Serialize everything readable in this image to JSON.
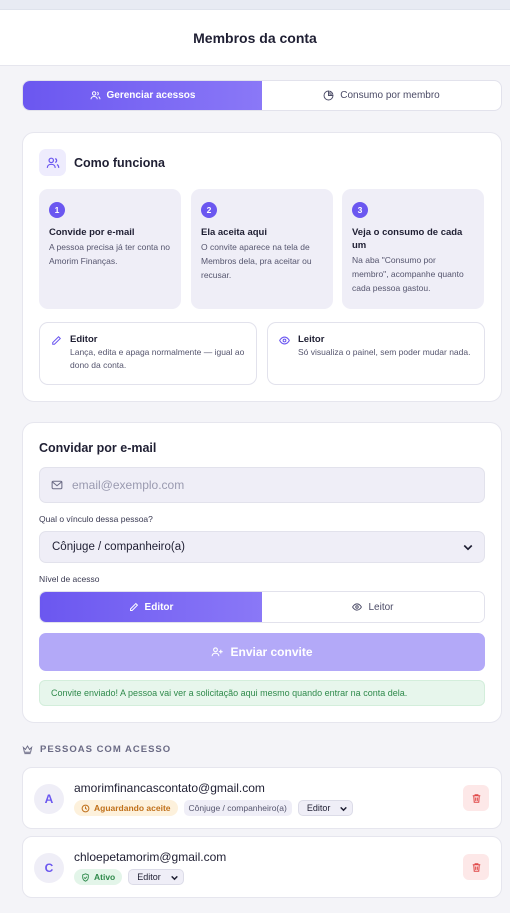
{
  "header": {
    "title": "Membros da conta"
  },
  "tabs": [
    {
      "label": "Gerenciar acessos",
      "icon": "users-icon",
      "active": true
    },
    {
      "label": "Consumo por membro",
      "icon": "pie-chart-icon",
      "active": false
    }
  ],
  "how_it_works": {
    "title": "Como funciona",
    "icon": "users-icon",
    "steps": [
      {
        "number": "1",
        "title": "Convide por e-mail",
        "description": "A pessoa precisa já ter conta no Amorim Finanças."
      },
      {
        "number": "2",
        "title": "Ela aceita aqui",
        "description": "O convite aparece na tela de Membros dela, pra aceitar ou recusar."
      },
      {
        "number": "3",
        "title": "Veja o consumo de cada um",
        "description": "Na aba \"Consumo por membro\", acompanhe quanto cada pessoa gastou."
      }
    ],
    "roles": [
      {
        "title": "Editor",
        "icon": "pencil-icon",
        "description": "Lança, edita e apaga normalmente — igual ao dono da conta."
      },
      {
        "title": "Leitor",
        "icon": "eye-icon",
        "description": "Só visualiza o painel, sem poder mudar nada."
      }
    ]
  },
  "invite": {
    "title": "Convidar por e-mail",
    "email_placeholder": "email@exemplo.com",
    "email_value": "",
    "relation_label": "Qual o vínculo dessa pessoa?",
    "relation_value": "Cônjuge / companheiro(a)",
    "level_label": "Nível de acesso",
    "levels": [
      {
        "label": "Editor",
        "icon": "pencil-icon",
        "active": true
      },
      {
        "label": "Leitor",
        "icon": "eye-icon",
        "active": false
      }
    ],
    "send_label": "Enviar convite",
    "success_message": "Convite enviado! A pessoa vai ver a solicitação aqui mesmo quando entrar na conta dela."
  },
  "members_section": {
    "title": "PESSOAS COM ACESSO",
    "icon": "crown-icon"
  },
  "members": [
    {
      "initial": "A",
      "email": "amorimfinancascontato@gmail.com",
      "status": "Aguardando aceite",
      "status_icon": "clock-icon",
      "relation": "Cônjuge / companheiro(a)",
      "role": "Editor"
    },
    {
      "initial": "C",
      "email": "chloepetamorim@gmail.com",
      "status": "Ativo",
      "status_icon": "shield-check-icon",
      "relation": "",
      "role": "Editor"
    }
  ],
  "colors": {
    "accent": "#6b57f0",
    "accent_light": "#b3a9f8",
    "success_bg": "#e7f6ec",
    "success_text": "#2f8a4b",
    "pending_bg": "#fdf1dc",
    "pending_text": "#c0701a",
    "danger_bg": "#fde8e8",
    "danger": "#e04848"
  }
}
